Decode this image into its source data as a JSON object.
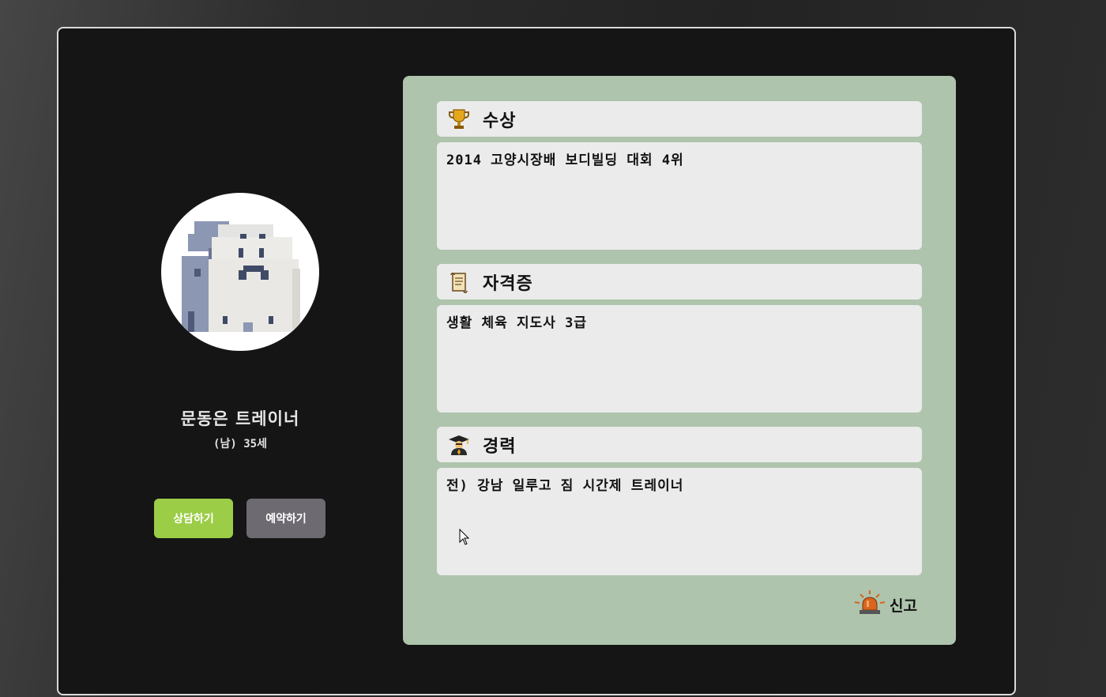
{
  "trainer": {
    "name": "문동은 트레이너",
    "meta": "(남) 35세"
  },
  "buttons": {
    "consult_label": "상담하기",
    "reserve_label": "예약하기"
  },
  "sections": {
    "awards": {
      "title": "수상",
      "icon": "trophy-icon",
      "content": "2014 고양시장배 보디빌딩 대회 4위"
    },
    "certificates": {
      "title": "자격증",
      "icon": "scroll-icon",
      "content": "생활 체육 지도사 3급"
    },
    "career": {
      "title": "경력",
      "icon": "graduate-icon",
      "content": "전) 강남 일루고 짐 시간제 트레이너"
    }
  },
  "report": {
    "label": "신고",
    "icon": "siren-icon"
  },
  "colors": {
    "modal_bg": "#151515",
    "panel_bg": "#aec4ac",
    "card_bg": "#ebebeb",
    "consult_button": "#9bcd46",
    "reserve_button": "#6d6a72"
  }
}
